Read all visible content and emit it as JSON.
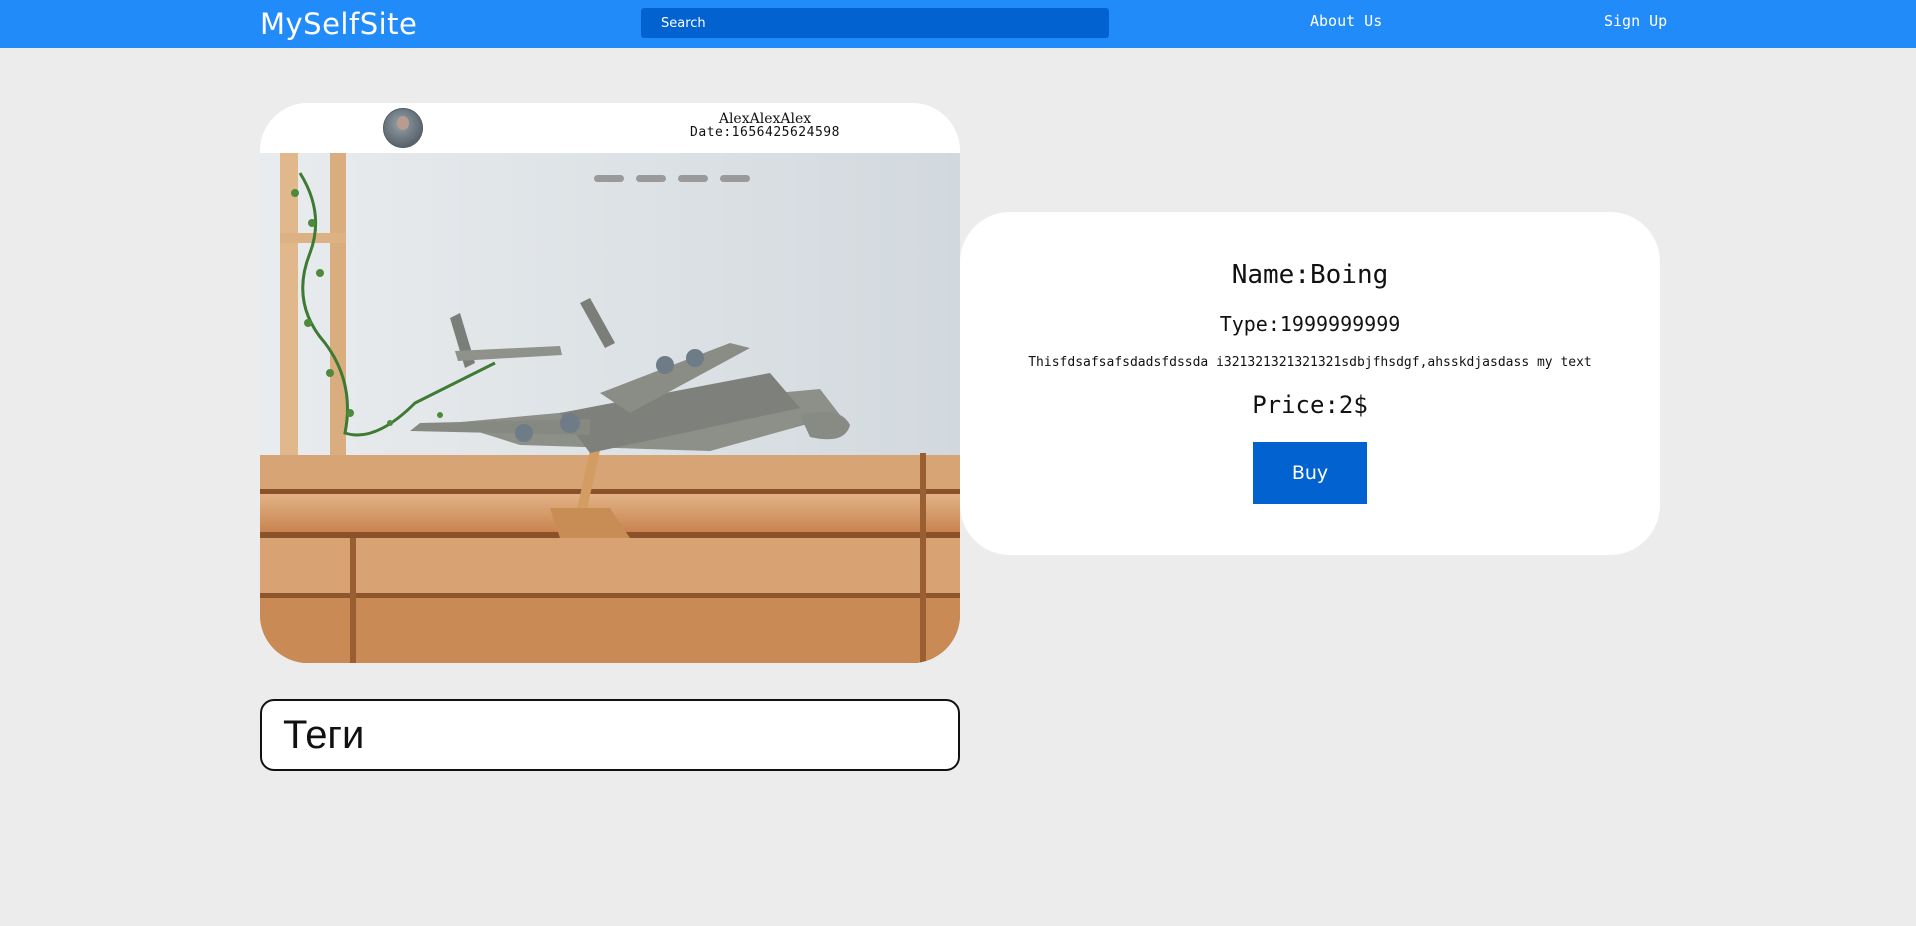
{
  "navbar": {
    "brand": "MySelfSite",
    "search_placeholder": "Search",
    "links": [
      {
        "label": "About Us"
      },
      {
        "label": "Sign Up"
      }
    ],
    "background_color": "#228bfa",
    "search_color": "#0263d0"
  },
  "post": {
    "author": "AlexAlexAlex",
    "date": "Date:1656425624598",
    "image_description": "Model airplane on a wooden stand",
    "carousel": {
      "slides": 4
    }
  },
  "tags": {
    "title": "Теги"
  },
  "product": {
    "name": "Name:Boing",
    "type": "Type:1999999999",
    "description": "Thisfdsafsafsdadsfdssda i321321321321321sdbjfhsdgf,ahsskdjasdass my text",
    "price": "Price:2$",
    "buy_label": "Buy",
    "accent_color": "#0263d0"
  },
  "icons": {
    "avatar": "user-avatar-icon"
  }
}
